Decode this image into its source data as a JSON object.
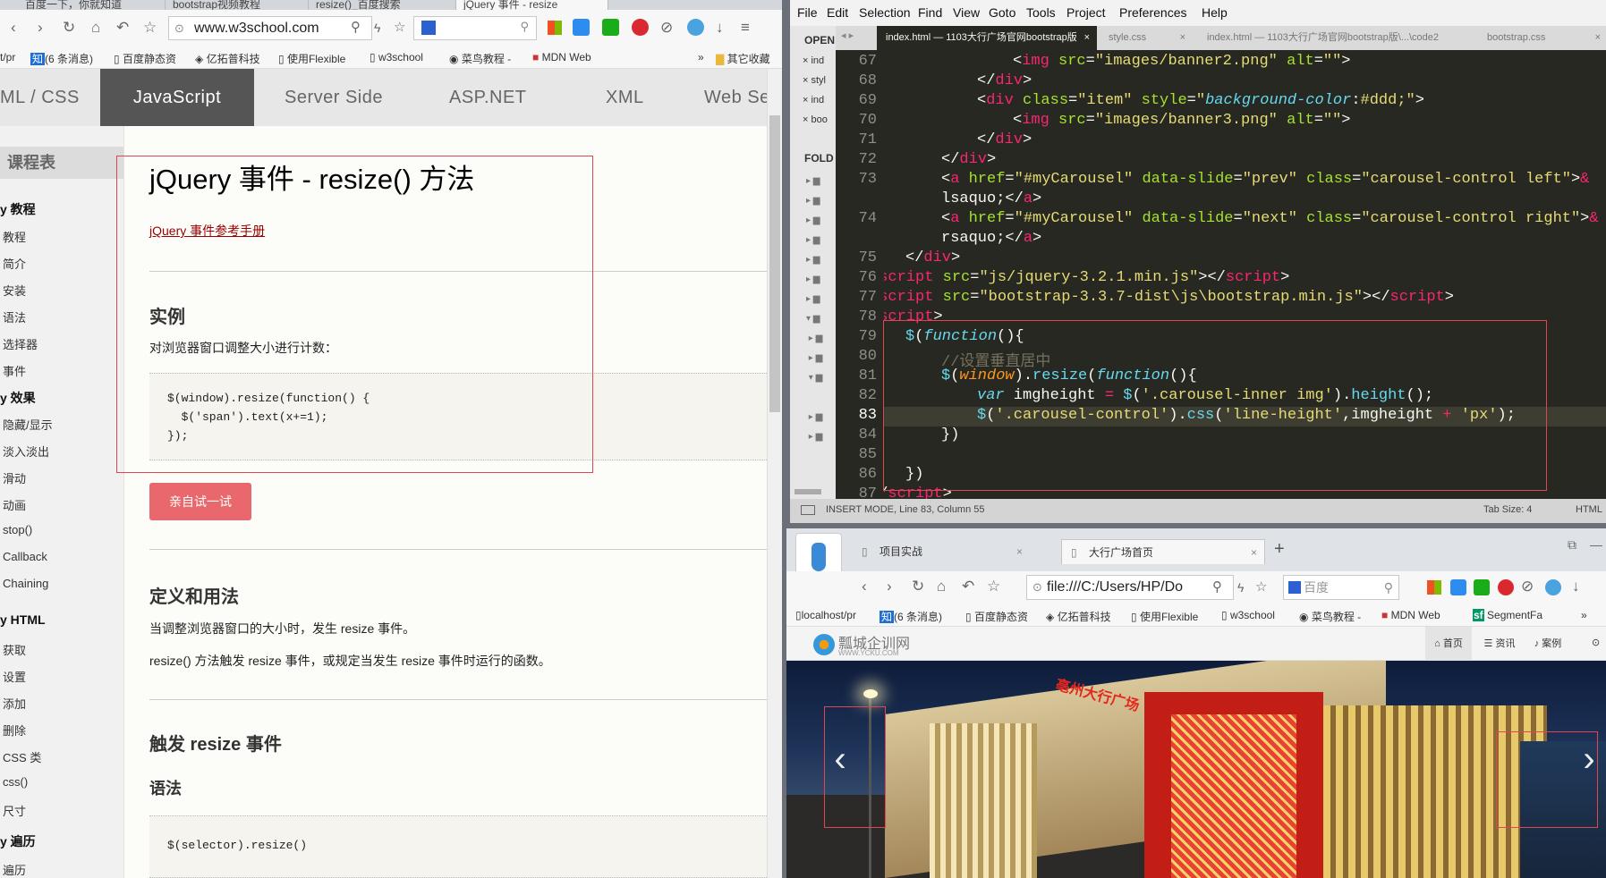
{
  "left_browser": {
    "tabs": [
      "百度一下，你就知道",
      "bootstrap视频教程",
      "resize()_百度搜索",
      "jQuery 事件 - resize"
    ],
    "url": "www.w3school.com",
    "bookmarks": [
      "t/pr",
      "(6 条消息)",
      "百度静态资",
      "亿拓普科技",
      "使用Flexible",
      "w3school",
      "菜鸟教程 -",
      "MDN Web",
      "其它收藏"
    ],
    "topnav": [
      "ML / CSS",
      "JavaScript",
      "Server Side",
      "ASP.NET",
      "XML",
      "Web Se"
    ],
    "sidebar": {
      "title": "课程表",
      "groups": [
        {
          "heading": "y 教程",
          "items": [
            "教程",
            "简介",
            "安装",
            "语法",
            "选择器",
            "事件"
          ]
        },
        {
          "heading": "y 效果",
          "items": [
            "隐藏/显示",
            "淡入淡出",
            "滑动",
            "动画",
            "stop()",
            "Callback",
            "Chaining"
          ]
        },
        {
          "heading": "y HTML",
          "items": [
            "获取",
            "设置",
            "添加",
            "删除",
            "CSS 类",
            "css()",
            "尺寸"
          ]
        },
        {
          "heading": "y 遍历",
          "items": [
            "遍历"
          ]
        }
      ]
    },
    "main": {
      "title": "jQuery 事件 - resize() 方法",
      "ref_link": "jQuery 事件参考手册",
      "example_heading": "实例",
      "example_desc": "对浏览器窗口调整大小进行计数：",
      "code_lines": [
        "$(window).resize(function() {",
        "  $('span').text(x+=1);",
        "});"
      ],
      "try_button": "亲自试一试",
      "def_heading": "定义和用法",
      "def_p1": "当调整浏览器窗口的大小时，发生 resize 事件。",
      "def_p2": "resize() 方法触发 resize 事件，或规定当发生 resize 事件时运行的函数。",
      "trigger_heading": "触发 resize 事件",
      "syntax_heading": "语法",
      "syntax_code": "$(selector).resize()"
    }
  },
  "sublime": {
    "menu": [
      "File",
      "Edit",
      "Selection",
      "Find",
      "View",
      "Goto",
      "Tools",
      "Project",
      "Preferences",
      "Help"
    ],
    "tabs": [
      "index.html — 1103大行广场官网bootstrap版",
      "style.css",
      "index.html — 1103大行广场官网bootstrap版\\...\\code2",
      "bootstrap.css"
    ],
    "sidebar_open": "OPEN",
    "sidebar_folders": "FOLD",
    "open_files": [
      "ind",
      "styl",
      "ind",
      "boo"
    ],
    "line_numbers": [
      "67",
      "68",
      "69",
      "70",
      "71",
      "72",
      "73",
      "",
      "74",
      "",
      "75",
      "76",
      "77",
      "78",
      "79",
      "80",
      "81",
      "82",
      "83",
      "84",
      "85",
      "86",
      "87"
    ],
    "status": "INSERT MODE, Line 83, Column 55",
    "tab_size": "Tab Size: 4",
    "syntax": "HTML"
  },
  "bottom_browser": {
    "tabs": [
      "项目实战",
      "大行广场首页"
    ],
    "url": "file:///C:/Users/HP/Do",
    "search_placeholder": "百度",
    "bookmarks": [
      "localhost/pr",
      "(6 条消息)",
      "百度静态资",
      "亿拓普科技",
      "使用Flexible",
      "w3school",
      "菜鸟教程 -",
      "MDN Web",
      "SegmentFa"
    ],
    "site_logo": "瓢城企训网",
    "site_logo_sub": "WWW.YCKU.COM",
    "site_nav": [
      "首页",
      "资讯",
      "案例"
    ],
    "banner_sign": "亳州大行广场",
    "carousel_prev": "‹",
    "carousel_next": "›"
  }
}
